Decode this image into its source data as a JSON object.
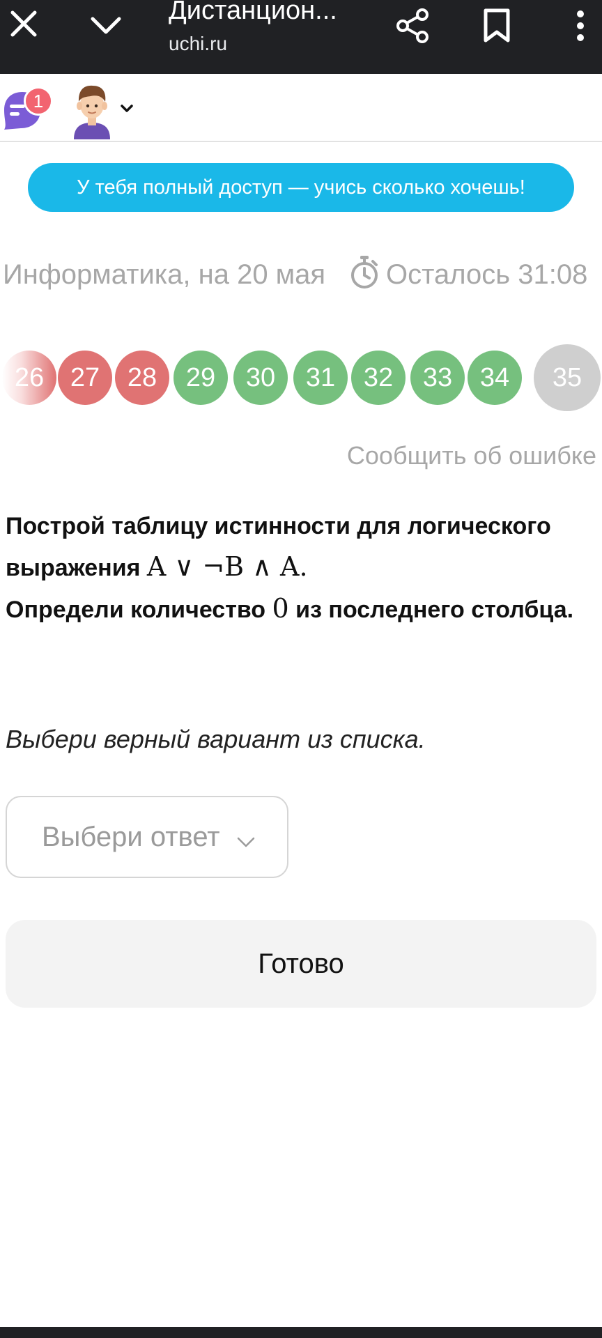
{
  "browser": {
    "title": "Дистанцион...",
    "url": "uchi.ru",
    "icons": [
      "close-icon",
      "chevron-down-icon",
      "share-icon",
      "bookmark-icon",
      "more-vert-icon"
    ]
  },
  "header": {
    "chat_badge_count": "1",
    "icons": [
      "chat-icon",
      "avatar-icon",
      "chevron-down-icon"
    ]
  },
  "banner": {
    "text": "У тебя полный доступ — учись сколько хочешь!"
  },
  "lesson": {
    "subject": "Информатика, на 20 мая",
    "timer_text": "Осталось 31:08",
    "timer_icon": "stopwatch-icon"
  },
  "pager": {
    "questions": [
      {
        "num": "26",
        "status": "wrong"
      },
      {
        "num": "27",
        "status": "wrong"
      },
      {
        "num": "28",
        "status": "wrong"
      },
      {
        "num": "29",
        "status": "right"
      },
      {
        "num": "30",
        "status": "right"
      },
      {
        "num": "31",
        "status": "right"
      },
      {
        "num": "32",
        "status": "right"
      },
      {
        "num": "33",
        "status": "right"
      },
      {
        "num": "34",
        "status": "right"
      },
      {
        "num": "35",
        "status": "current"
      }
    ]
  },
  "report_error": "Сообщить об ошибке",
  "question": {
    "part1": "Построй таблицу истинности для логического выражения ",
    "formula": "A ∨ ¬B ∧ A.",
    "part2": "Определи количество ",
    "zero": "0",
    "part3": " из последнего столбца."
  },
  "hint": "Выбери верный вариант из списка.",
  "answer_select": {
    "placeholder": "Выбери ответ"
  },
  "done_button": "Готово",
  "colors": {
    "topbar": "#202124",
    "banner": "#1ab8e8",
    "wrong": "#e07373",
    "right": "#76c07e",
    "current": "#cfcfcf",
    "badge": "#f26470",
    "chat": "#7b5cd6"
  }
}
